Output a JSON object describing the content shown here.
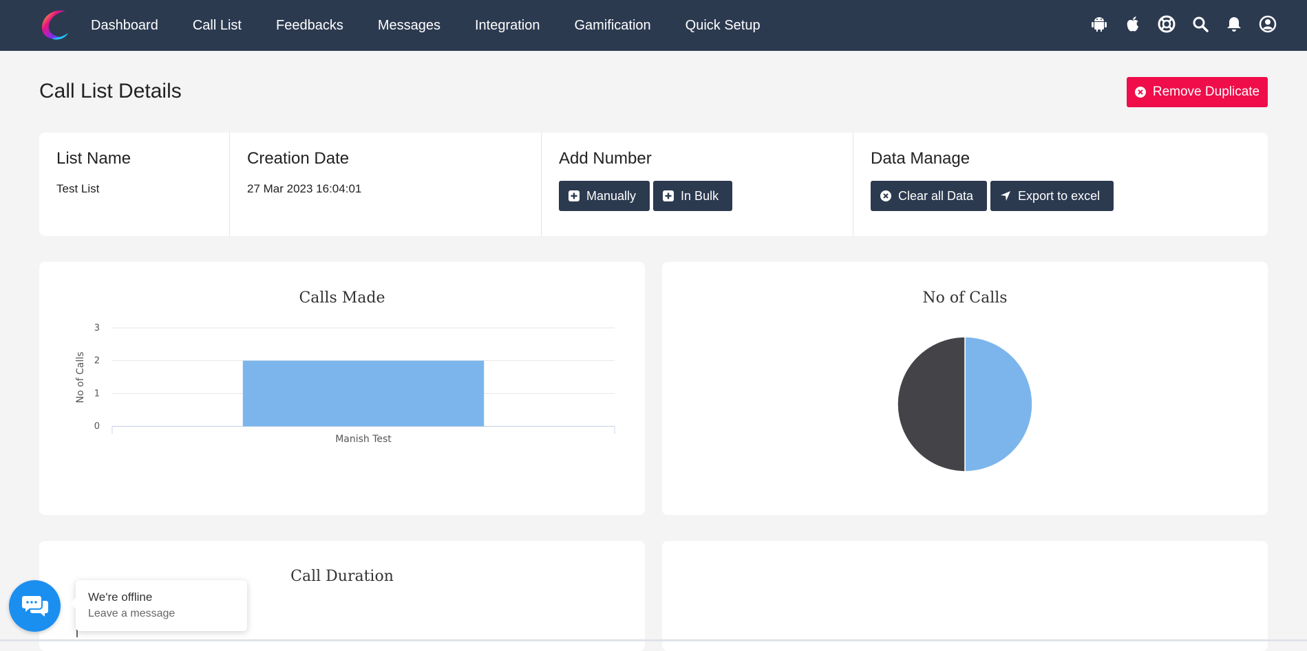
{
  "nav": {
    "items": [
      "Dashboard",
      "Call List",
      "Feedbacks",
      "Messages",
      "Integration",
      "Gamification",
      "Quick Setup"
    ],
    "icons": [
      "android-icon",
      "apple-icon",
      "support-icon",
      "search-icon",
      "bell-icon",
      "user-icon"
    ]
  },
  "page": {
    "title": "Call List Details",
    "remove_duplicate_label": "Remove Duplicate"
  },
  "info": {
    "list_name_label": "List Name",
    "list_name_value": "Test List",
    "creation_date_label": "Creation Date",
    "creation_date_value": "27 Mar 2023 16:04:01",
    "add_number_label": "Add Number",
    "manually_label": "Manually",
    "in_bulk_label": "In Bulk",
    "data_manage_label": "Data Manage",
    "clear_all_label": "Clear all Data",
    "export_label": "Export to excel"
  },
  "charts": {
    "call_duration_title": "Call Duration"
  },
  "chart_data": [
    {
      "type": "bar",
      "title": "Calls Made",
      "ylabel": "No of Calls",
      "xlabel": "",
      "categories": [
        "Manish Test"
      ],
      "values": [
        2
      ],
      "yticks": [
        "0",
        "1",
        "2",
        "3"
      ],
      "ylim": [
        0,
        3
      ],
      "grid": true,
      "color": "#7cb5ec"
    },
    {
      "type": "pie",
      "title": "No of Calls",
      "values": [
        50,
        50
      ],
      "colors": [
        "#7cb5ec",
        "#434348"
      ]
    }
  ],
  "chat": {
    "status": "We're offline",
    "action": "Leave a message"
  },
  "colors": {
    "navbar": "#2c3a50",
    "accent_red": "#ef0d4a",
    "chat_blue": "#1b8ff0"
  }
}
